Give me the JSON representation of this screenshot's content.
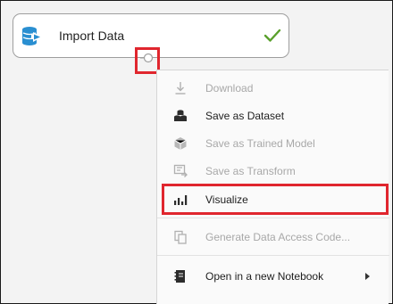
{
  "module": {
    "title": "Import Data",
    "icon": "import-data-icon",
    "status_icon": "checkmark-icon",
    "status_color": "#5aa02c",
    "icon_color": "#2a8fd1"
  },
  "context_menu": {
    "items": [
      {
        "label": "Download",
        "icon": "download-icon",
        "enabled": false
      },
      {
        "label": "Save as Dataset",
        "icon": "dataset-icon",
        "enabled": true
      },
      {
        "label": "Save as Trained Model",
        "icon": "trained-model-icon",
        "enabled": false
      },
      {
        "label": "Save as Transform",
        "icon": "transform-icon",
        "enabled": false
      },
      {
        "label": "Visualize",
        "icon": "bar-chart-icon",
        "enabled": true
      },
      {
        "label": "Generate Data Access Code...",
        "icon": "copy-code-icon",
        "enabled": false
      },
      {
        "label": "Open in a new Notebook",
        "icon": "notebook-icon",
        "enabled": true,
        "has_submenu": true
      }
    ]
  },
  "highlight_color": "#e0262e"
}
